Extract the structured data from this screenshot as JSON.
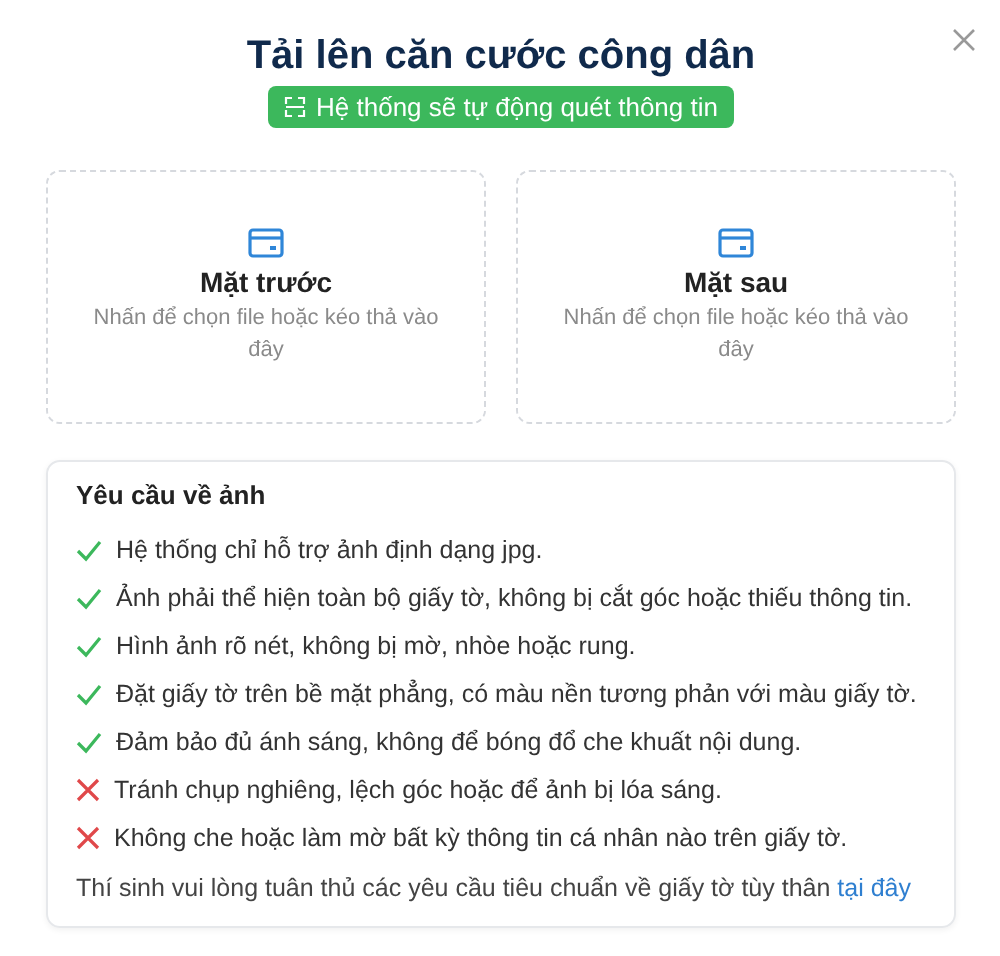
{
  "dialog": {
    "title": "Tải lên căn cước công dân",
    "badge": "Hệ thống sẽ tự động quét thông tin"
  },
  "upload_cards": [
    {
      "title": "Mặt trước",
      "hint": "Nhấn để chọn file hoặc kéo thả vào đây"
    },
    {
      "title": "Mặt sau",
      "hint": "Nhấn để chọn file hoặc kéo thả vào đây"
    }
  ],
  "requirements": {
    "heading": "Yêu cầu về ảnh",
    "items": [
      {
        "kind": "allowed",
        "text": "Hệ thống chỉ hỗ trợ ảnh định dạng jpg."
      },
      {
        "kind": "allowed",
        "text": "Ảnh phải thể hiện toàn bộ giấy tờ, không bị cắt góc hoặc thiếu thông tin."
      },
      {
        "kind": "allowed",
        "text": "Hình ảnh rõ nét, không bị mờ, nhòe hoặc rung."
      },
      {
        "kind": "allowed",
        "text": "Đặt giấy tờ trên bề mặt phẳng, có màu nền tương phản với màu giấy tờ."
      },
      {
        "kind": "allowed",
        "text": "Đảm bảo đủ ánh sáng, không để bóng đổ che khuất nội dung."
      },
      {
        "kind": "forbidden",
        "text": "Tránh chụp nghiêng, lệch góc hoặc để ảnh bị lóa sáng."
      },
      {
        "kind": "forbidden",
        "text": "Không che hoặc làm mờ bất kỳ thông tin cá nhân nào trên giấy tờ."
      }
    ],
    "note": "Thí sinh vui lòng tuân thủ các yêu cầu tiêu chuẩn về giấy tờ tùy thân",
    "note_link": "tại đây"
  }
}
